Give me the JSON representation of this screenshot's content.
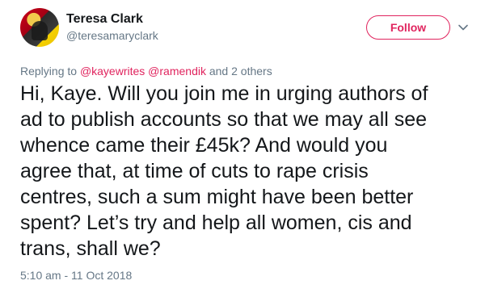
{
  "author": {
    "name": "Teresa Clark",
    "handle": "@teresamaryclark",
    "avatar_icon": "profile-photo"
  },
  "follow_button": {
    "label": "Follow",
    "color": "#e0245e"
  },
  "menu": {
    "icon": "chevron-down-icon"
  },
  "replying": {
    "prefix": "Replying to",
    "mention_1": "@kayewrites",
    "mention_2": "@ramendik",
    "suffix": "and 2 others"
  },
  "tweet": {
    "lines": [
      "Hi, Kaye. Will you join me in urging authors of",
      "ad to publish accounts so that we may all see",
      "whence came their £45k? And would you",
      "agree that, at time of cuts to rape crisis",
      "centres, such a sum might have been better",
      "spent? Let’s try and help all women, cis and",
      "trans, shall we?"
    ],
    "timestamp": "5:10 am - 11 Oct 2018"
  },
  "colors": {
    "accent": "#e0245e",
    "muted": "#657786",
    "text": "#14171a"
  }
}
